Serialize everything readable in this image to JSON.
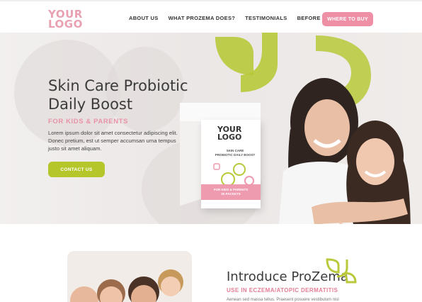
{
  "header": {
    "logo": [
      "YOUR",
      "LOGO"
    ],
    "nav": [
      "ABOUT US",
      "WHAT PROZEMA DOES?",
      "TESTIMONIALS",
      "BEFORE & AFTER"
    ],
    "cta": "WHERE TO BUY"
  },
  "hero": {
    "title_lines": [
      "Skin Care Probiotic",
      "Daily Boost"
    ],
    "subtitle": "FOR KIDS & PARENTS",
    "body": "Lorem ipsum dolor sit amet consectetur adipiscing elit. Donec pretium, est ut semper accumsan urna tempus justo sit amet aliquam.",
    "cta": "CONTACT US",
    "product": {
      "logo": [
        "YOUR",
        "LOGO"
      ],
      "text": [
        "SKIN CARE",
        "PROBIOTIC DAILY BOOST"
      ],
      "band": [
        "FOR KIDS & PARENTS",
        "30 PACKETS"
      ]
    }
  },
  "intro": {
    "title": "Introduce ProZema",
    "subtitle": "USE IN ECZEMA/ATOPIC DERMATITIS",
    "body": "Aenean sed massa tellus. Praesent posuere vestibulum nisl"
  },
  "colors": {
    "pink": "#ee8fa5",
    "lime": "#b5c62a",
    "dark_text": "#3b3b3b"
  }
}
